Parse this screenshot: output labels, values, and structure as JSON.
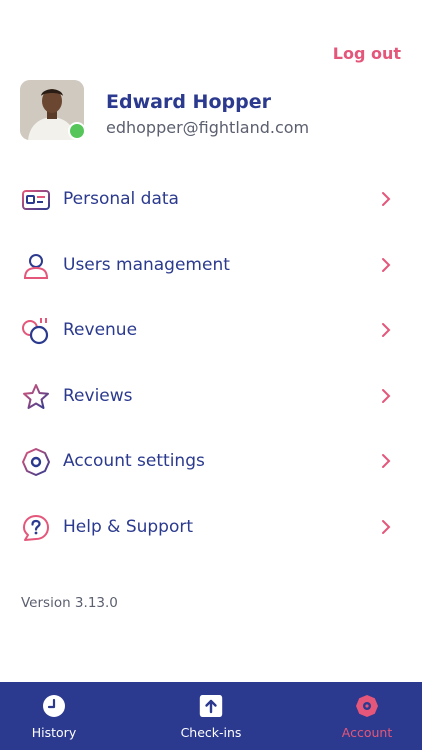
{
  "header": {
    "logout_label": "Log out"
  },
  "profile": {
    "name": "Edward Hopper",
    "email": "edhopper@fightland.com",
    "status": "online"
  },
  "menu": [
    {
      "label": "Personal data",
      "icon": "id-card-icon"
    },
    {
      "label": "Users management",
      "icon": "user-icon"
    },
    {
      "label": "Revenue",
      "icon": "coins-icon"
    },
    {
      "label": "Reviews",
      "icon": "star-icon"
    },
    {
      "label": "Account settings",
      "icon": "settings-gear-icon"
    },
    {
      "label": "Help & Support",
      "icon": "help-bubble-icon"
    }
  ],
  "version": "Version 3.13.0",
  "tabbar": {
    "tabs": [
      {
        "label": "History",
        "icon": "clock-icon",
        "active": false
      },
      {
        "label": "Check-ins",
        "icon": "upload-arrow-icon",
        "active": false
      },
      {
        "label": "Account",
        "icon": "gear-icon",
        "active": true
      }
    ]
  },
  "colors": {
    "primary": "#2b3a8e",
    "accent": "#e4567a",
    "online": "#56c65b",
    "text_muted": "#5b5f6e"
  }
}
